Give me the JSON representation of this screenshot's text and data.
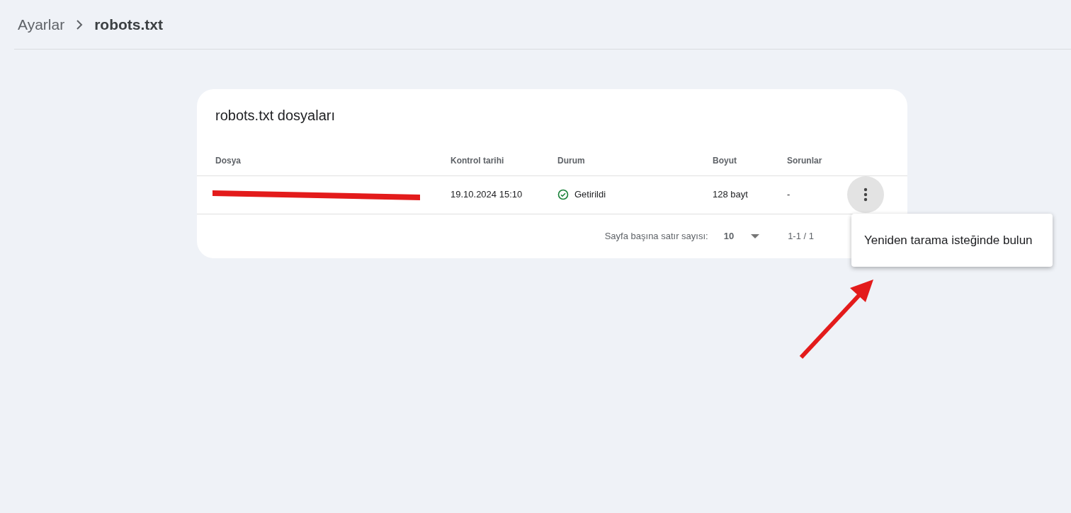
{
  "breadcrumb": [
    {
      "label": "Ayarlar",
      "current": false
    },
    {
      "label": "robots.txt",
      "current": true
    }
  ],
  "card": {
    "title": "robots.txt dosyaları",
    "columns": [
      "Dosya",
      "Kontrol tarihi",
      "Durum",
      "Boyut",
      "Sorunlar"
    ],
    "rows": [
      {
        "file_redacted": true,
        "checked": "19.10.2024 15:10",
        "status": {
          "label": "Getirildi",
          "kind": "success"
        },
        "size": "128 bayt",
        "issues": "-"
      }
    ],
    "footer": {
      "rows_per_page_label": "Sayfa başına satır sayısı:",
      "rows_per_page": "10",
      "range": "1-1 / 1"
    }
  },
  "menu": {
    "items": [
      "Yeniden tarama isteğinde bulun"
    ]
  },
  "annotation": {
    "kind": "arrow"
  }
}
